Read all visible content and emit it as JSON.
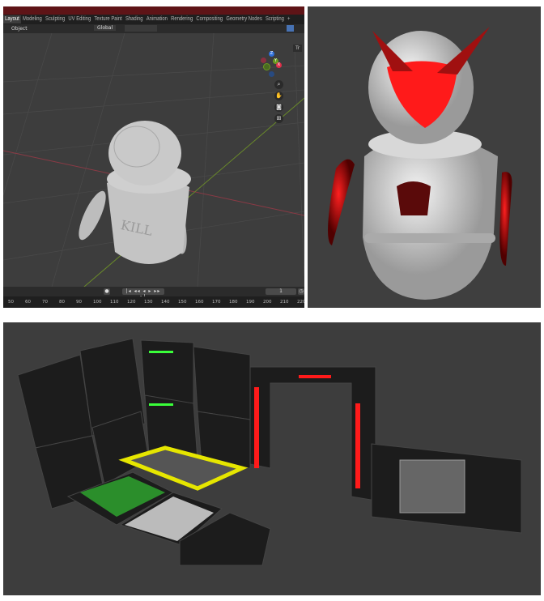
{
  "blender": {
    "workspace_tabs": [
      "Layout",
      "Modeling",
      "Sculpting",
      "UV Editing",
      "Texture Paint",
      "Shading",
      "Animation",
      "Rendering",
      "Compositing",
      "Geometry Nodes",
      "Scripting",
      "+"
    ],
    "active_tab": "Layout",
    "header": {
      "object_menu": "Object",
      "transform_orientation": "Global"
    },
    "overlay_label": "Tr",
    "gizmo_axes": {
      "z": "Z",
      "y": "Y",
      "x": "X"
    },
    "model_text": "KILL",
    "timeline": {
      "current_frame": "1",
      "ticks": [
        "50",
        "60",
        "70",
        "80",
        "90",
        "100",
        "110",
        "120",
        "130",
        "140",
        "150",
        "160",
        "170",
        "180",
        "190",
        "200",
        "210",
        "220"
      ]
    }
  },
  "colors": {
    "title_bar": "#5e1417",
    "viewport": "#3d3d3d",
    "glow_red": "#ff1a1a",
    "glow_green": "#3aff3a",
    "glow_yellow": "#e6e600"
  }
}
